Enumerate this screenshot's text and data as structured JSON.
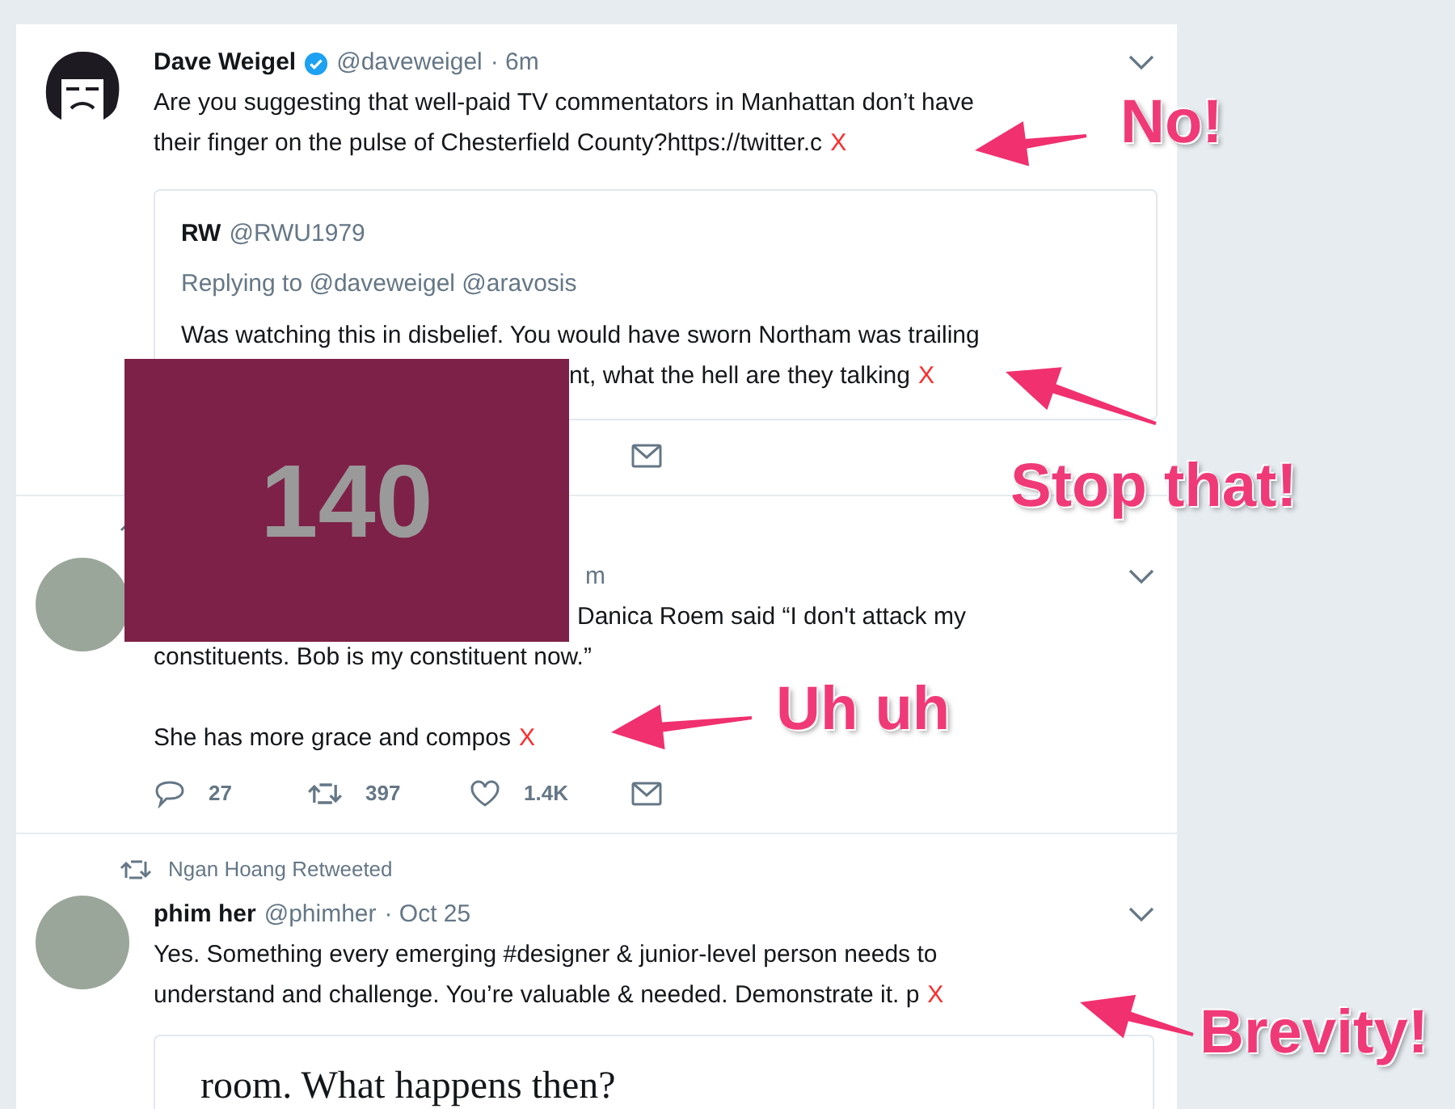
{
  "tweets": [
    {
      "avatar": {
        "kind": "drawing"
      },
      "author": {
        "name": "Dave Weigel",
        "verified": true,
        "handle": "@daveweigel",
        "time": "· 6m"
      },
      "paragraphs": [
        {
          "lines": [
            {
              "text": "Are you suggesting that well-paid TV commentators in Manhattan don’t have",
              "covered": false
            },
            {
              "text": "their finger on the pulse of Chesterfield County?https://twitter.c",
              "covered": false,
              "cut_mark": "X"
            }
          ]
        }
      ],
      "quote": {
        "name": "RW",
        "handle": "@RWU1979",
        "replying": "Replying to @daveweigel @aravosis",
        "lines": [
          {
            "text": "Was watching this in disbelief. You would have sworn Northam was trailing",
            "covered": false
          },
          {
            "text": "nt, what the hell are they talking",
            "covered": true,
            "cut_mark": "X"
          }
        ]
      },
      "actions": [
        {
          "kind": "mail"
        }
      ]
    },
    {
      "avatar": {
        "kind": "photo"
      },
      "retweeted": true,
      "author": {
        "time": "m"
      },
      "paragraphs": [
        {
          "lines": [
            {
              "text": "Danica Roem said “I don't attack my",
              "covered": true
            },
            {
              "text": "constituents. Bob is my constituent now.”",
              "covered": false
            }
          ]
        },
        {
          "lines": [
            {
              "text": "She has more grace and compos",
              "covered": false,
              "cut_mark": "X"
            }
          ]
        }
      ],
      "actions": [
        {
          "kind": "reply",
          "count": "27"
        },
        {
          "kind": "retweet",
          "count": "397"
        },
        {
          "kind": "like",
          "count": "1.4K"
        },
        {
          "kind": "mail"
        }
      ]
    },
    {
      "avatar": {
        "kind": "photo"
      },
      "retweeted": true,
      "context_text": "Ngan Hoang Retweeted",
      "author": {
        "name": "phim her",
        "verified": false,
        "handle": "@phimher",
        "time": "· Oct 25"
      },
      "paragraphs": [
        {
          "lines": [
            {
              "text": "Yes. Something every emerging #designer & junior-level person needs to",
              "covered": false
            },
            {
              "text": "understand and challenge. You’re valuable & needed. Demonstrate it. p",
              "covered": false,
              "cut_mark": "X"
            }
          ]
        }
      ],
      "card": {
        "text": "room. What happens then?"
      }
    }
  ],
  "overlay": {
    "text": "140"
  },
  "annotations": [
    {
      "text": "No!"
    },
    {
      "text": "Stop that!"
    },
    {
      "text": "Uh uh"
    },
    {
      "text": "Brevity!"
    }
  ]
}
